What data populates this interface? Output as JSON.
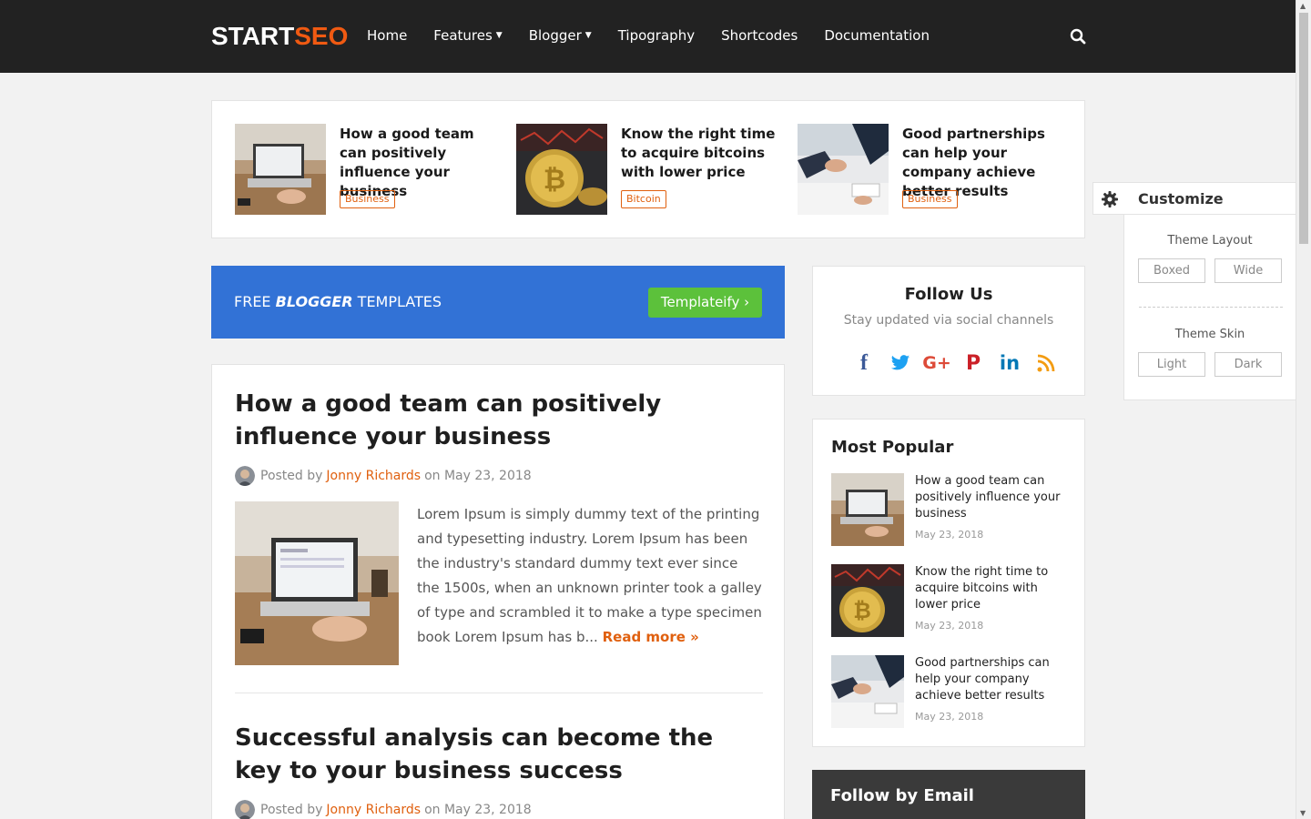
{
  "header": {
    "logo_primary": "START",
    "logo_accent": "SEO",
    "nav": [
      {
        "label": "Home",
        "dropdown": false
      },
      {
        "label": "Features",
        "dropdown": true
      },
      {
        "label": "Blogger",
        "dropdown": true
      },
      {
        "label": "Tipography",
        "dropdown": false
      },
      {
        "label": "Shortcodes",
        "dropdown": false
      },
      {
        "label": "Documentation",
        "dropdown": false
      }
    ],
    "search_icon": "search-icon"
  },
  "featured": [
    {
      "title": "How a good team can positively influence your business",
      "tag": "Business",
      "image": "laptop-desk-photo"
    },
    {
      "title": "Know the right time to acquire bitcoins with lower price",
      "tag": "Bitcoin",
      "image": "bitcoin-coin-photo"
    },
    {
      "title": "Good partnerships can help your company achieve better results",
      "tag": "Business",
      "image": "handshake-photo"
    }
  ],
  "banner": {
    "prefix": "FREE",
    "emphasis": "BLOGGER",
    "suffix": "TEMPLATES",
    "button": "Templateify ›"
  },
  "posts": [
    {
      "title": "How a good team can positively influence your business",
      "posted_by": "Posted by",
      "author": "Jonny Richards",
      "on": "on May 23, 2018",
      "excerpt": "Lorem Ipsum is simply dummy text of the printing and typesetting industry. Lorem Ipsum has been the industry's standard dummy text ever since the 1500s, when an unknown printer took a galley of type and scrambled it to make a type specimen book Lorem Ipsum has b...",
      "read_more": "Read more »"
    },
    {
      "title": "Successful analysis can become the key to your business success",
      "posted_by": "Posted by",
      "author": "Jonny Richards",
      "on": "on May 23, 2018"
    }
  ],
  "follow": {
    "title": "Follow Us",
    "subtitle": "Stay updated via social channels",
    "networks": [
      {
        "icon": "facebook-icon",
        "glyph": "f",
        "color": "#3b5998"
      },
      {
        "icon": "twitter-icon",
        "glyph": "🐦",
        "color": "#1da1f2"
      },
      {
        "icon": "google-plus-icon",
        "glyph": "G+",
        "color": "#dd4b39"
      },
      {
        "icon": "pinterest-icon",
        "glyph": "P",
        "color": "#cb2027"
      },
      {
        "icon": "linkedin-icon",
        "glyph": "in",
        "color": "#0077b5"
      },
      {
        "icon": "rss-icon",
        "glyph": "◔",
        "color": "#f39c12"
      }
    ]
  },
  "popular": {
    "title": "Most Popular",
    "items": [
      {
        "title": "How a good team can positively influence your business",
        "date": "May 23, 2018"
      },
      {
        "title": "Know the right time to acquire bitcoins with lower price",
        "date": "May 23, 2018"
      },
      {
        "title": "Good partnerships can help your company achieve better results",
        "date": "May 23, 2018"
      }
    ]
  },
  "email": {
    "title": "Follow by Email"
  },
  "customize": {
    "label": "Customize",
    "layout_label": "Theme Layout",
    "layout_options": [
      "Boxed",
      "Wide"
    ],
    "skin_label": "Theme Skin",
    "skin_options": [
      "Light",
      "Dark"
    ]
  },
  "colors": {
    "accent": "#e0600f",
    "banner": "#3272d6",
    "button_green": "#5cc13b",
    "header_bg": "#222222"
  }
}
